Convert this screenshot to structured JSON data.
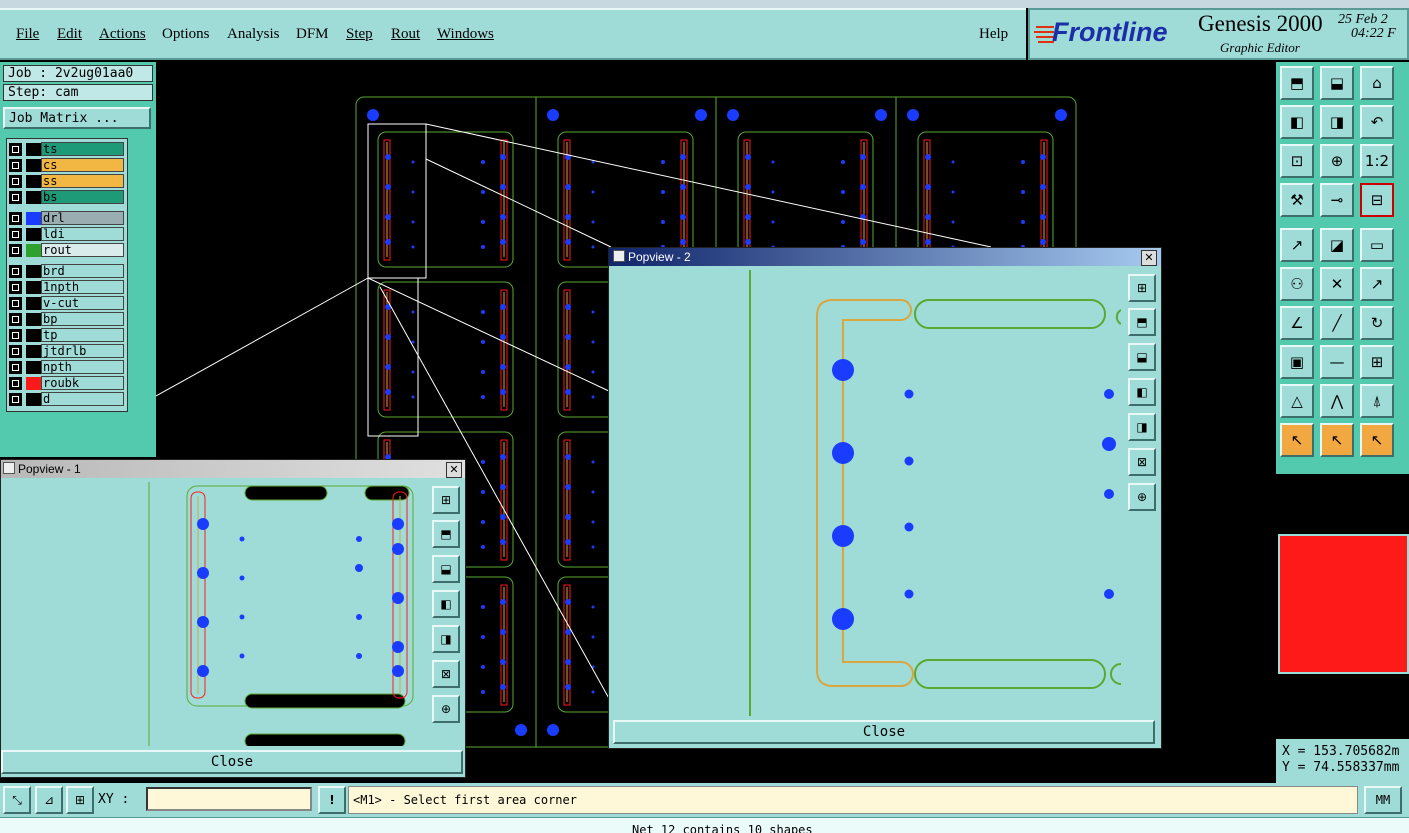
{
  "menu": {
    "items": [
      "File",
      "Edit",
      "Actions",
      "Options",
      "Analysis",
      "DFM",
      "Step",
      "Rout",
      "Windows"
    ],
    "help": "Help"
  },
  "brand": {
    "logo": "Frontline",
    "product": "Genesis 2000",
    "subtitle": "Graphic Editor",
    "date": "25 Feb 2",
    "time": "04:22 F"
  },
  "job": {
    "job_label": "Job : 2v2ug01aa0",
    "step_label": "Step: cam",
    "matrix_button": "Job Matrix ..."
  },
  "layers": [
    {
      "name": "ts",
      "color": "#2a9a7a",
      "bg": "#1f9a78",
      "swatch": "#000"
    },
    {
      "name": "cs",
      "color": "#f2b742",
      "bg": "#f2b742",
      "swatch": "#000"
    },
    {
      "name": "ss",
      "color": "#f2b742",
      "bg": "#f2b742",
      "swatch": "#000"
    },
    {
      "name": "bs",
      "color": "#2a9a7a",
      "bg": "#1f9a78",
      "swatch": "#000"
    },
    {
      "name": "drl",
      "bg": "#9aaeb2",
      "swatch": "#1a3cff"
    },
    {
      "name": "ldi",
      "bg": "#9fdcd8",
      "swatch": "#000"
    },
    {
      "name": "rout",
      "bg": "#d9ebeb",
      "swatch": "#2ea12e"
    },
    {
      "name": "brd",
      "bg": "#9fdcd8",
      "swatch": "#000"
    },
    {
      "name": "1npth",
      "bg": "#9fdcd8",
      "swatch": "#000"
    },
    {
      "name": "v-cut",
      "bg": "#9fdcd8",
      "swatch": "#000"
    },
    {
      "name": "bp",
      "bg": "#9fdcd8",
      "swatch": "#000"
    },
    {
      "name": "tp",
      "bg": "#9fdcd8",
      "swatch": "#000"
    },
    {
      "name": "jtdrlb",
      "bg": "#9fdcd8",
      "swatch": "#000"
    },
    {
      "name": "npth",
      "bg": "#9fdcd8",
      "swatch": "#000"
    },
    {
      "name": "roubk",
      "bg": "#9fdcd8",
      "swatch": "#ff1a1a"
    },
    {
      "name": "d",
      "bg": "#9fdcd8",
      "swatch": "#000"
    }
  ],
  "popup1": {
    "title": "Popview - 1",
    "close": "Close"
  },
  "popup2": {
    "title": "Popview - 2",
    "close": "Close"
  },
  "coords": {
    "x": "X = 153.705682m",
    "y": "Y = 74.558337mm"
  },
  "status": {
    "xy_label": "XY :",
    "xy_value": "",
    "message": "<M1> - Select first area corner",
    "units": "MM",
    "bottom_message": "Net 12 contains 10 shapes"
  },
  "colors": {
    "panel": "#9fdcd8",
    "accent": "#53c9ad",
    "board_outline": "#5aa832",
    "rout": "#d9a640",
    "drill": "#1a3cff",
    "roubk": "#ff1a1a"
  }
}
